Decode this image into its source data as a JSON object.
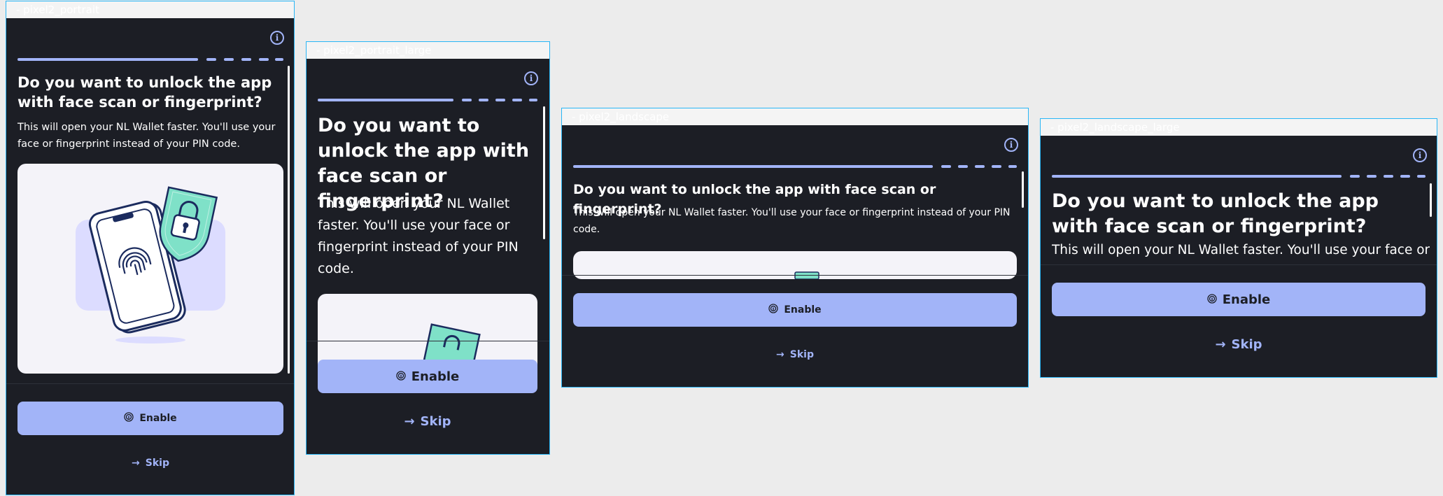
{
  "devices": [
    {
      "label": "- pixel2_portrait"
    },
    {
      "label": "- pixel2_portrait_large"
    },
    {
      "label": "- pixel2_landscape"
    },
    {
      "label": "- pixel2_landscape_large"
    }
  ],
  "screen": {
    "info_icon_glyph": "i",
    "title": "Do you want to unlock the app with face scan or fingerprint?",
    "description": "This will open your NL Wallet faster. You'll use your face or fingerprint instead of your PIN code.",
    "enable_label": "Enable",
    "skip_label": "Skip",
    "arrow_glyph": "→",
    "progress_steps_completed": 1
  },
  "colors": {
    "background": "#1c1e25",
    "accent": "#a2b4f8",
    "shield": "#7fe1c8",
    "illustration_bg": "#dcdcff",
    "card": "#f4f3f9",
    "phone_outline": "#1b2b5e"
  }
}
